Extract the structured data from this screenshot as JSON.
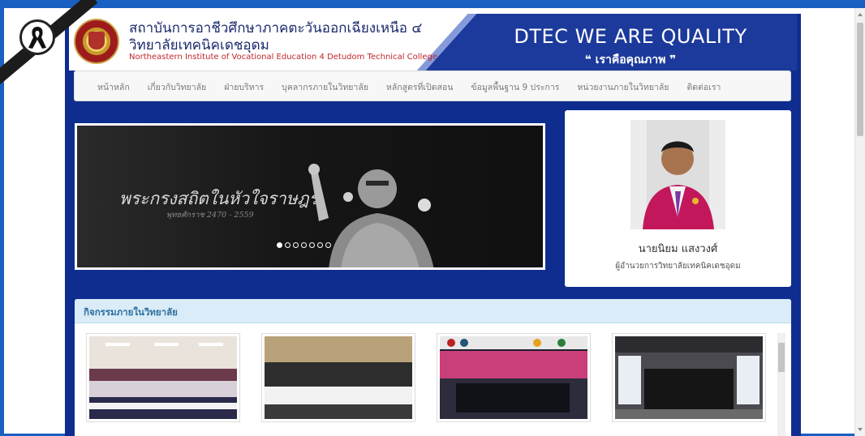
{
  "header": {
    "institution_th_line1": "สถาบันการอาชีวศึกษาภาคตะวันออกเฉียงเหนือ ๔",
    "institution_th_line2": "วิทยาลัยเทคนิคเดชอุดม",
    "institution_en": "Northeastern Institute of Vocational Education 4 Detudom Technical College",
    "slogan": "DTEC WE ARE QUALITY",
    "tagline": "❝ เราคือคุณภาพ ❞"
  },
  "nav": {
    "items": [
      "หน้าหลัก",
      "เกี่ยวกับวิทยาลัย",
      "ฝ่ายบริหาร",
      "บุคลากรภายในวิทยาลัย",
      "หลักสูตรที่เปิดสอน",
      "ข้อมูลพื้นฐาน 9 ประการ",
      "หน่วยงานภายในวิทยาลัย",
      "ติดต่อเรา"
    ]
  },
  "slider": {
    "caption": "พระกรงสถิตในหัวใจราษฎร์",
    "subcaption": "พุทธศักราช 2470 - 2559",
    "slide_count": 7,
    "active_slide": 1
  },
  "director": {
    "name": "นายนิยม แสงวงศ์",
    "title": "ผู้อำนวยการวิทยาลัยเทคนิคเดชอุดม"
  },
  "activities": {
    "title": "กิจกรรมภายในวิทยาลัย",
    "thumbnails": [
      "activity-photo-1",
      "activity-photo-2",
      "activity-photo-3",
      "activity-photo-4"
    ]
  },
  "colors": {
    "frame": "#1a5fc2",
    "page_background": "#0f2d8f",
    "header_blue": "#1c3a9b",
    "institution_en": "#c0262d",
    "panel_header": "#d9ecf7"
  }
}
